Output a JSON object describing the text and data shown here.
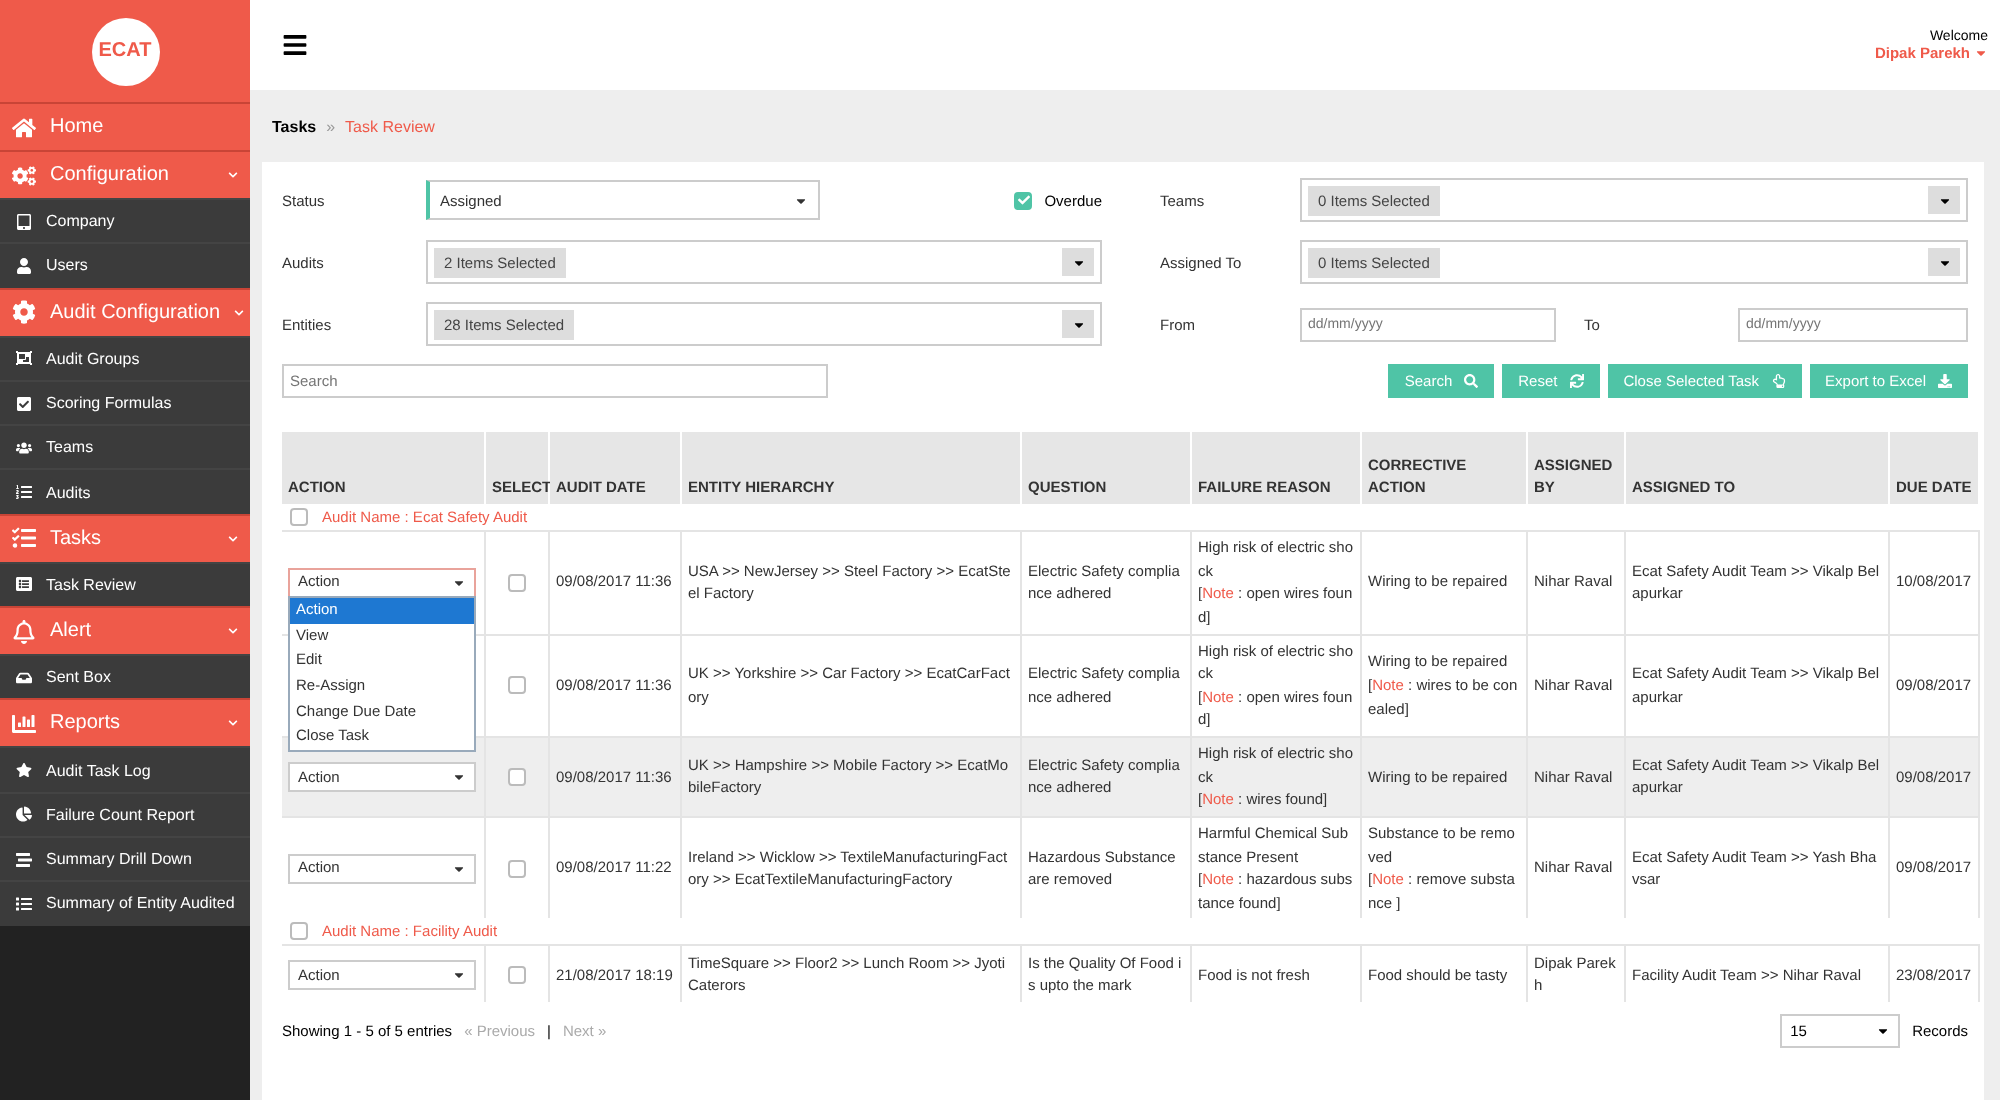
{
  "sidebar": {
    "logo": "ECAT",
    "items": [
      {
        "label": "Home",
        "kind": "section",
        "expandable": false
      },
      {
        "label": "Configuration",
        "kind": "section",
        "expandable": true
      },
      {
        "label": "Company",
        "kind": "link"
      },
      {
        "label": "Users",
        "kind": "link"
      },
      {
        "label": "Audit Configuration",
        "kind": "section",
        "expandable": true
      },
      {
        "label": "Audit Groups",
        "kind": "link"
      },
      {
        "label": "Scoring Formulas",
        "kind": "link"
      },
      {
        "label": "Teams",
        "kind": "link"
      },
      {
        "label": "Audits",
        "kind": "link"
      },
      {
        "label": "Tasks",
        "kind": "section",
        "expandable": true
      },
      {
        "label": "Task Review",
        "kind": "link"
      },
      {
        "label": "Alert",
        "kind": "section",
        "expandable": true
      },
      {
        "label": "Sent Box",
        "kind": "link"
      },
      {
        "label": "Reports",
        "kind": "section",
        "expandable": true
      },
      {
        "label": "Audit Task Log",
        "kind": "link"
      },
      {
        "label": "Failure Count Report",
        "kind": "link"
      },
      {
        "label": "Summary Drill Down",
        "kind": "link"
      },
      {
        "label": "Summary of Entity Audited",
        "kind": "link"
      }
    ]
  },
  "header": {
    "welcome": "Welcome",
    "user": "Dipak Parekh"
  },
  "breadcrumb": {
    "parent": "Tasks",
    "separator": "»",
    "current": "Task Review"
  },
  "filters": {
    "status": {
      "label": "Status",
      "value": "Assigned"
    },
    "overdue": {
      "label": "Overdue",
      "checked": true
    },
    "audits": {
      "label": "Audits",
      "chip": "2 Items Selected"
    },
    "entities": {
      "label": "Entities",
      "chip": "28 Items Selected"
    },
    "teams": {
      "label": "Teams",
      "chip": "0 Items Selected"
    },
    "assigned_to": {
      "label": "Assigned To",
      "chip": "0 Items Selected"
    },
    "from": {
      "label": "From",
      "placeholder": "dd/mm/yyyy"
    },
    "to": {
      "label": "To",
      "placeholder": "dd/mm/yyyy"
    },
    "search": {
      "placeholder": "Search"
    }
  },
  "buttons": [
    {
      "label": "Search",
      "kind": "search"
    },
    {
      "label": "Reset",
      "kind": "reset"
    },
    {
      "label": "Close Selected Task",
      "kind": "close"
    },
    {
      "label": "Export to Excel",
      "kind": "export"
    }
  ],
  "table": {
    "columns": [
      "ACTION",
      "SELECT",
      "AUDIT DATE",
      "ENTITY HIERARCHY",
      "QUESTION",
      "FAILURE REASON",
      "CORRECTIVE ACTION",
      "ASSIGNED BY",
      "ASSIGNED TO",
      "DUE DATE"
    ],
    "groups": [
      {
        "name": "Audit Name : Ecat Safety Audit",
        "checked": false,
        "rows": [
          {
            "action": "Action",
            "selected": false,
            "highlighted": false,
            "audit_date": "09/08/2017 11:36",
            "entity": "USA >> NewJersey >> Steel Factory >> EcatSteel Factory",
            "question": "Electric Safety compliance adhered",
            "failure_reason": {
              "text": "High risk of electric shock",
              "note": {
                "open": "[",
                "label": "Note",
                "body": " : open wires found]"
              }
            },
            "corrective_action": {
              "text": "Wiring to be repaired"
            },
            "assigned_by": "Nihar Raval",
            "assigned_to": "Ecat Safety Audit Team >> Vikalp Belapurkar",
            "due_date": "10/08/2017",
            "menu": [
              {
                "label": "Action",
                "selected": true
              },
              {
                "label": "View",
                "selected": false
              },
              {
                "label": "Edit",
                "selected": false
              },
              {
                "label": "Re-Assign",
                "selected": false
              },
              {
                "label": "Change Due Date",
                "selected": false
              },
              {
                "label": "Close Task",
                "selected": false
              }
            ]
          },
          {
            "selected": false,
            "highlighted": false,
            "audit_date": "09/08/2017 11:36",
            "entity": "UK >> Yorkshire >> Car Factory >> EcatCarFactory",
            "question": "Electric Safety compliance adhered",
            "failure_reason": {
              "text": "High risk of electric shock",
              "note": {
                "open": "[",
                "label": "Note",
                "body": " : open wires found]"
              }
            },
            "corrective_action": {
              "text": "Wiring to be repaired",
              "note": {
                "open": "[",
                "label": "Note",
                "body": " : wires to be conealed]"
              }
            },
            "assigned_by": "Nihar Raval",
            "assigned_to": "Ecat Safety Audit Team >> Vikalp Belapurkar",
            "due_date": "09/08/2017"
          },
          {
            "action": "Action",
            "selected": false,
            "highlighted": true,
            "audit_date": "09/08/2017 11:36",
            "entity": "UK >> Hampshire >> Mobile Factory >> EcatMobileFactory",
            "question": "Electric Safety compliance adhered",
            "failure_reason": {
              "text": "High risk of electric shock",
              "note": {
                "open": "[",
                "label": "Note",
                "body": " : wires found]"
              }
            },
            "corrective_action": {
              "text": "Wiring to be repaired"
            },
            "assigned_by": "Nihar Raval",
            "assigned_to": "Ecat Safety Audit Team >> Vikalp Belapurkar",
            "due_date": "09/08/2017"
          },
          {
            "action": "Action",
            "selected": false,
            "highlighted": false,
            "audit_date": "09/08/2017 11:22",
            "entity": "Ireland >> Wicklow >> TextileManufacturingFactory >> EcatTextileManufacturingFactory",
            "question": "Hazardous Substance are removed",
            "failure_reason": {
              "text": "Harmful Chemical Substance Present",
              "note": {
                "open": "[",
                "label": "Note",
                "body": " : hazardous substance found]"
              }
            },
            "corrective_action": {
              "text": "Substance to be removed",
              "note": {
                "open": "[",
                "label": "Note",
                "body": " : remove substance ]"
              }
            },
            "assigned_by": "Nihar Raval",
            "assigned_to": "Ecat Safety Audit Team >> Yash Bhavsar",
            "due_date": "09/08/2017"
          }
        ]
      },
      {
        "name": "Audit Name : Facility Audit",
        "checked": false,
        "rows": [
          {
            "action": "Action",
            "selected": false,
            "highlighted": false,
            "audit_date": "21/08/2017 18:19",
            "entity": "TimeSquare >> Floor2 >> Lunch Room >> JyotiCaterors",
            "question": "Is the Quality Of Food is upto the mark",
            "failure_reason": {
              "text": "Food is not fresh"
            },
            "corrective_action": {
              "text": "Food should be tasty"
            },
            "assigned_by": "Dipak Parekh",
            "assigned_to": "Facility Audit Team >> Nihar Raval",
            "due_date": "23/08/2017"
          }
        ]
      }
    ]
  },
  "footer": {
    "summary": "Showing 1 - 5 of 5 entries",
    "previous": {
      "label": "« Previous",
      "disabled": true
    },
    "divider": "|",
    "next": {
      "label": "Next »",
      "disabled": true
    },
    "page_size": "15",
    "records_label": "Records"
  }
}
